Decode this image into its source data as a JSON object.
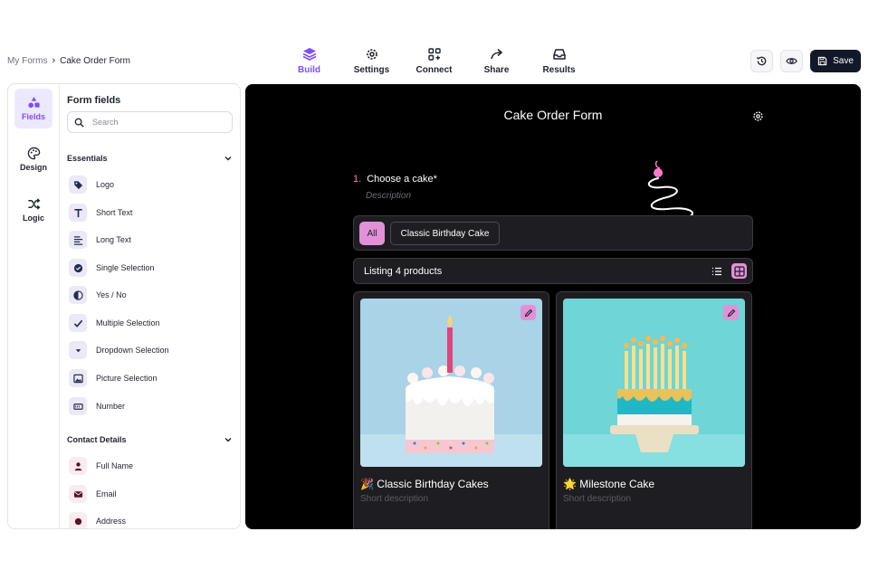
{
  "breadcrumb": {
    "root": "My Forms",
    "separator": "›",
    "current": "Cake Order Form"
  },
  "nav": {
    "tabs": [
      {
        "label": "Build",
        "icon": "layers-icon",
        "active": true
      },
      {
        "label": "Settings",
        "icon": "gear-icon",
        "active": false
      },
      {
        "label": "Connect",
        "icon": "connect-icon",
        "active": false
      },
      {
        "label": "Share",
        "icon": "share-icon",
        "active": false
      },
      {
        "label": "Results",
        "icon": "inbox-icon",
        "active": false
      }
    ]
  },
  "actions": {
    "history_icon": "history-icon",
    "preview_icon": "eye-icon",
    "save_label": "Save"
  },
  "rail": {
    "items": [
      {
        "label": "Fields",
        "icon": "shapes-icon",
        "active": true
      },
      {
        "label": "Design",
        "icon": "palette-icon",
        "active": false
      },
      {
        "label": "Logic",
        "icon": "shuffle-icon",
        "active": false
      }
    ]
  },
  "panel": {
    "title": "Form fields",
    "search_placeholder": "Search",
    "sections": [
      {
        "title": "Essentials",
        "items": [
          {
            "label": "Logo",
            "icon": "tag-icon"
          },
          {
            "label": "Short Text",
            "icon": "text-icon"
          },
          {
            "label": "Long Text",
            "icon": "paragraph-icon"
          },
          {
            "label": "Single Selection",
            "icon": "check-circle-icon"
          },
          {
            "label": "Yes / No",
            "icon": "toggle-icon"
          },
          {
            "label": "Multiple Selection",
            "icon": "checkmark-icon"
          },
          {
            "label": "Dropdown Selection",
            "icon": "caret-down-icon"
          },
          {
            "label": "Picture Selection",
            "icon": "image-icon"
          },
          {
            "label": "Number",
            "icon": "number-icon"
          }
        ]
      },
      {
        "title": "Contact Details",
        "items": [
          {
            "label": "Full Name",
            "icon": "person-icon"
          },
          {
            "label": "Email",
            "icon": "envelope-icon"
          },
          {
            "label": "Address",
            "icon": "location-icon"
          }
        ]
      }
    ]
  },
  "preview": {
    "form_title": "Cake Order Form",
    "question_number": "1.",
    "question_label": "Choose a cake*",
    "question_description": "Description",
    "filters": {
      "all_label": "All",
      "chip_label": "Classic Birthday Cake"
    },
    "listing_text": "Listing 4 products",
    "accent_color": "#e291d8",
    "cards": [
      {
        "emoji": "🎉",
        "title": "Classic Birthday Cakes",
        "description": "Short description"
      },
      {
        "emoji": "🌟",
        "title": "Milestone Cake",
        "description": "Short description"
      }
    ]
  }
}
